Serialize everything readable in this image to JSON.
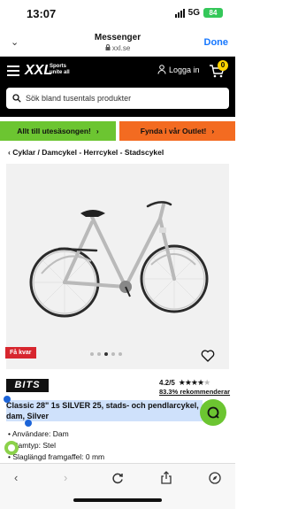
{
  "status": {
    "time": "13:07",
    "network": "5G",
    "battery": "84"
  },
  "browser": {
    "title": "Messenger",
    "url": "xxl.se",
    "done_label": "Done"
  },
  "site": {
    "logo": "XXL",
    "tagline_1": "Sports",
    "tagline_2": "unite all",
    "login_label": "Logga in",
    "cart_count": "0",
    "search_placeholder": "Sök bland tusentals produkter"
  },
  "promos": [
    {
      "label": "Allt till utesäsongen!",
      "color": "#6cc531"
    },
    {
      "label": "Fynda i vår Outlet!",
      "color": "#f36b21"
    }
  ],
  "breadcrumb": "Cyklar / Damcykel - Herrcykel - Stadscykel",
  "image": {
    "badge": "Få kvar",
    "slide_count": 5,
    "active_slide": 3
  },
  "product": {
    "brand": "BITS",
    "rating": "4.2/5",
    "stars_filled": 4,
    "recommend": "83.3% rekommenderar",
    "title": "Classic 28\" 1s SILVER 25, stads- och pendlarcykel, dam, Silver",
    "specs": [
      "Användare: Dam",
      "Ramtyp: Stel",
      "Slaglängd framgaffel: 0 mm"
    ]
  },
  "colors": {
    "accent_green": "#6cc531",
    "accent_orange": "#f36b21",
    "badge_red": "#d7262e",
    "link_blue": "#1677ff"
  }
}
